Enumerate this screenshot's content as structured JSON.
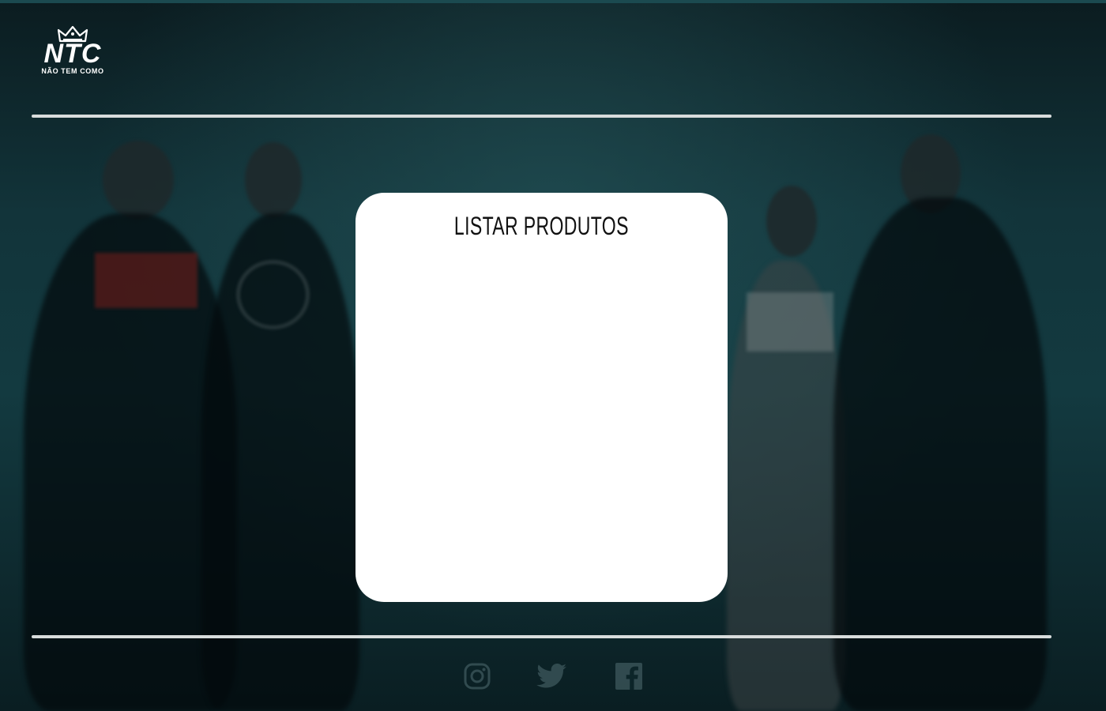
{
  "brand": {
    "logo_text": "NTC",
    "logo_subtitle": "NÃO TEM COMO"
  },
  "main": {
    "card_title": "LISTAR PRODUTOS"
  },
  "footer": {
    "social": [
      {
        "name": "instagram",
        "icon": "instagram-icon"
      },
      {
        "name": "twitter",
        "icon": "twitter-icon"
      },
      {
        "name": "facebook",
        "icon": "facebook-icon"
      }
    ]
  },
  "colors": {
    "background_dark": "#0b1c20",
    "background_teal": "#133a40",
    "divider": "#d8dcdc",
    "card": "#ffffff",
    "title_text": "#111111",
    "social_icon": "#5f7d82"
  }
}
